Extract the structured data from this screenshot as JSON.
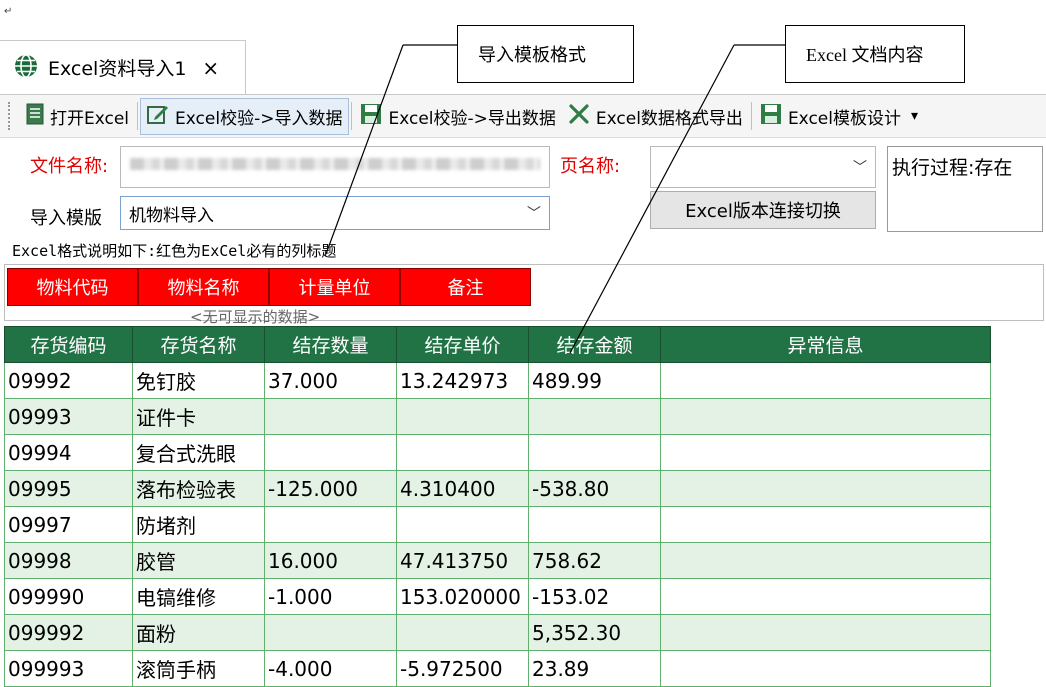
{
  "paragraph_mark": "↵",
  "callouts": {
    "template_format": "导入模板格式",
    "excel_content": "Excel 文档内容"
  },
  "tab": {
    "title": "Excel资料导入1",
    "close": "×"
  },
  "toolbar": {
    "open_excel": "打开Excel",
    "validate_import": "Excel校验->导入数据",
    "validate_export": "Excel校验->导出数据",
    "format_export": "Excel数据格式导出",
    "template_design": "Excel模板设计",
    "more": "▾"
  },
  "form": {
    "file_name_label": "文件名称:",
    "sheet_name_label": "页名称:",
    "sheet_name_value": "",
    "template_label": "导入模版",
    "template_value": "机物料导入",
    "switch_button": "Excel版本连接切换",
    "exec_log": "执行过程:存在"
  },
  "template": {
    "note": "Excel格式说明如下:红色为ExCel必有的列标题",
    "required_columns": [
      "物料代码",
      "物料名称",
      "计量单位",
      "备注"
    ],
    "empty_hint": "<无可显示的数据>"
  },
  "grid": {
    "columns": [
      "存货编码",
      "存货名称",
      "结存数量",
      "结存单价",
      "结存金额",
      "异常信息"
    ],
    "rows": [
      [
        "09992",
        "免钉胶",
        "37.000",
        "13.242973",
        "489.99",
        ""
      ],
      [
        "09993",
        "证件卡",
        "",
        "",
        "",
        ""
      ],
      [
        "09994",
        "复合式洗眼",
        "",
        "",
        "",
        ""
      ],
      [
        "09995",
        "落布检验表",
        "-125.000",
        "4.310400",
        "-538.80",
        ""
      ],
      [
        "09997",
        "防堵剂",
        "",
        "",
        "",
        ""
      ],
      [
        "09998",
        "胶管",
        "16.000",
        "47.413750",
        "758.62",
        ""
      ],
      [
        "099990",
        "电镐维修",
        "-1.000",
        "153.020000",
        "-153.02",
        ""
      ],
      [
        "099992",
        "面粉",
        "",
        "",
        "5,352.30",
        ""
      ],
      [
        "099993",
        "滚筒手柄",
        "-4.000",
        "-5.972500",
        "23.89",
        ""
      ]
    ]
  },
  "colors": {
    "header_green": "#217346",
    "row_alt": "#e3f2e5",
    "required_red": "#ff0000",
    "label_red": "#e00000"
  },
  "icons": {
    "tab": "globe-icon",
    "open_excel": "document-icon",
    "validate_import": "edit-icon",
    "validate_export": "save-icon",
    "format_export": "x-icon",
    "template_design": "save-icon"
  }
}
